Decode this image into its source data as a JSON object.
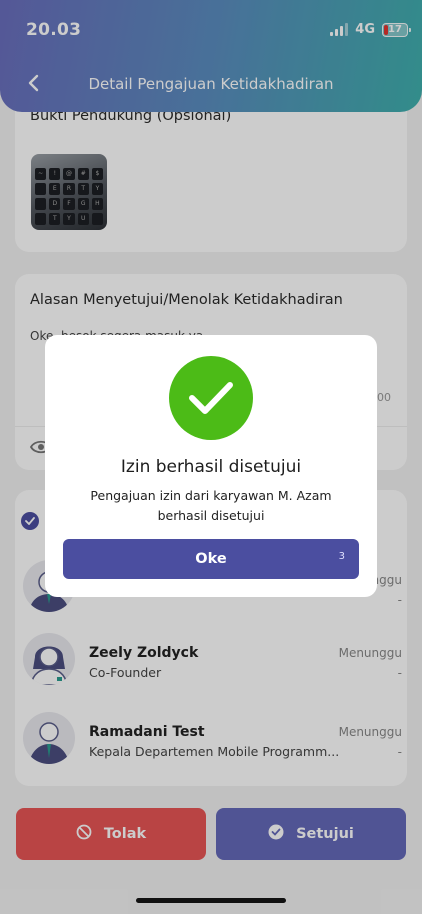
{
  "status_bar": {
    "time": "20.03",
    "network": "4G",
    "battery": "17"
  },
  "header": {
    "title": "Detail Pengajuan Ketidakhadiran"
  },
  "proof": {
    "title": "Bukti Pendukung (Opsional)"
  },
  "reason": {
    "title": "Alasan Menyetujui/Menolak Ketidakhadiran",
    "text": "Oke, besok segera masuk ya",
    "time": ":00"
  },
  "approvers": [
    {
      "name": "",
      "role": "",
      "status": "nggu",
      "dash": "-"
    },
    {
      "name": "Zeely Zoldyck",
      "role": "Co-Founder",
      "status": "Menunggu",
      "dash": "-"
    },
    {
      "name": "Ramadani Test",
      "role": "Kepala Departemen Mobile Programm...",
      "status": "Menunggu",
      "dash": "-"
    }
  ],
  "actions": {
    "reject_label": "Tolak",
    "approve_label": "Setujui"
  },
  "modal": {
    "title": "Izin berhasil disetujui",
    "message": "Pengajuan izin dari karyawan M. Azam berhasil disetujui",
    "ok_label": "Oke",
    "countdown": "3"
  },
  "colors": {
    "primary": "#4b4ea0",
    "success": "#4cbb17",
    "reject": "#e85656",
    "header_gradient_start": "#6a6ebd",
    "header_gradient_end": "#3fb0ad"
  }
}
